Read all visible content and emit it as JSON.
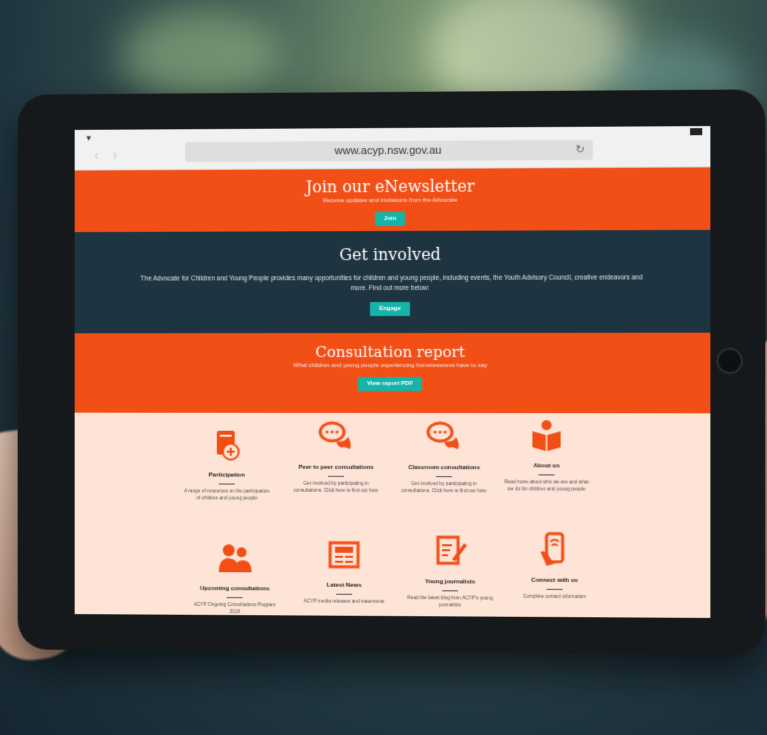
{
  "browser": {
    "url": "www.acyp.nsw.gov.au",
    "nav_back": "‹",
    "nav_forward": "›",
    "reload_icon": "reload-icon"
  },
  "newsletter": {
    "title": "Join our eNewsletter",
    "subtitle": "Receive updates and invitations from the Advocate",
    "button": "Join"
  },
  "get_involved": {
    "title": "Get involved",
    "text": "The Advocate for Children and Young People provides many opportunities for children and young people, including events, the Youth Advisory Council, creative endeavors and more. Find out more below:",
    "button": "Engage"
  },
  "consultation": {
    "title": "Consultation report",
    "subtitle": "What children and young people experiencing homelessness have to say",
    "button": "View report PDF"
  },
  "tiles": [
    {
      "title": "Participation",
      "desc": "A range of resources on the participation of children and young people",
      "icon": "book-hand-icon"
    },
    {
      "title": "Peer to peer consultations",
      "desc": "Get involved by participating in consultations. Click here to find out how.",
      "icon": "chat-bubbles-icon"
    },
    {
      "title": "Classroom consultations",
      "desc": "Get involved by participating in consultations. Click here to find out how.",
      "icon": "chat-bubbles-icon"
    },
    {
      "title": "About us",
      "desc": "Read more about who we are and what we do for children and young people",
      "icon": "reader-icon"
    },
    {
      "title": "Upcoming consultations",
      "desc": "ACYP Ongoing Consultations Program 2016",
      "icon": "people-icon"
    },
    {
      "title": "Latest News",
      "desc": "ACYP media releases and statements",
      "icon": "newspaper-icon"
    },
    {
      "title": "Young journalists",
      "desc": "Read the latest blog from ACYP's young journalists",
      "icon": "notepad-pen-icon"
    },
    {
      "title": "Connect with us",
      "desc": "Complete contact information",
      "icon": "phone-hand-icon"
    }
  ],
  "colors": {
    "accent_orange": "#f24f17",
    "navy": "#1e3441",
    "teal_button": "#16b3a8",
    "tile_bg": "#fde4d7"
  }
}
